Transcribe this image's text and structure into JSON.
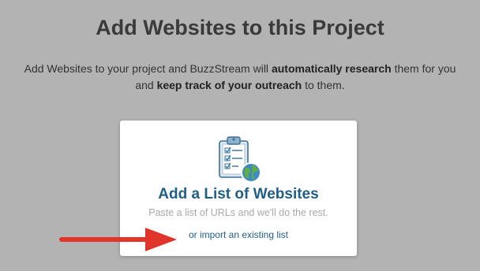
{
  "header": {
    "title": "Add Websites to this Project"
  },
  "intro": {
    "part1": "Add Websites to your project and BuzzStream will ",
    "bold1": "automatically research",
    "part2": " them for you",
    "part3": "and ",
    "bold2": "keep track of your outreach",
    "part4": " to them."
  },
  "card": {
    "icon": "clipboard-checklist-globe-icon",
    "title": "Add a List of Websites",
    "subtitle": "Paste a list of URLs and we'll do the rest.",
    "import_link": "or import an existing list"
  },
  "annotation": {
    "icon": "red-arrow-icon",
    "color": "#e0352b"
  },
  "colors": {
    "background": "#b3b3b3",
    "link": "#1f5f85",
    "arrow": "#e0352b"
  }
}
